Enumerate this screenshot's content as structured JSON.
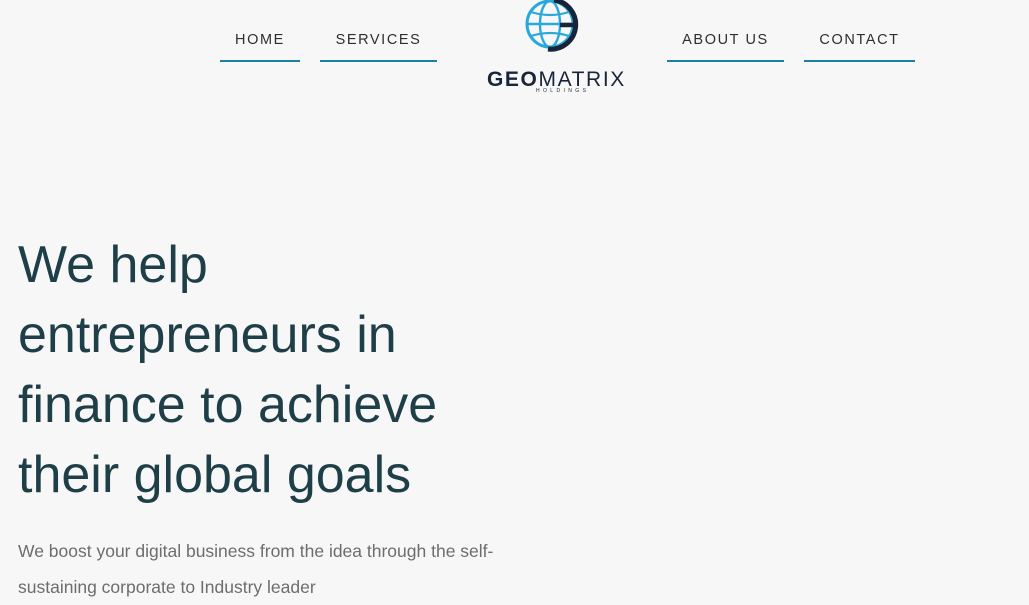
{
  "nav": {
    "home": "HOME",
    "services": "SERVICES",
    "about": "ABOUT US",
    "contact": "CONTACT"
  },
  "logo": {
    "word_bold": "GEO",
    "word_light": "MATRIX",
    "subtitle": "HOLDINGS"
  },
  "hero": {
    "title": "We help entrepreneurs in finance to achieve their global goals",
    "subtitle": "We boost your digital business from the idea through the self-sustaining corporate to Industry leader"
  },
  "colors": {
    "background": "#f7f7f7",
    "accent": "#1c7fa8",
    "heading": "#1e3e48",
    "body_text": "#6d6d6d",
    "logo_globe": "#29a9d9",
    "logo_dark": "#17243a"
  }
}
